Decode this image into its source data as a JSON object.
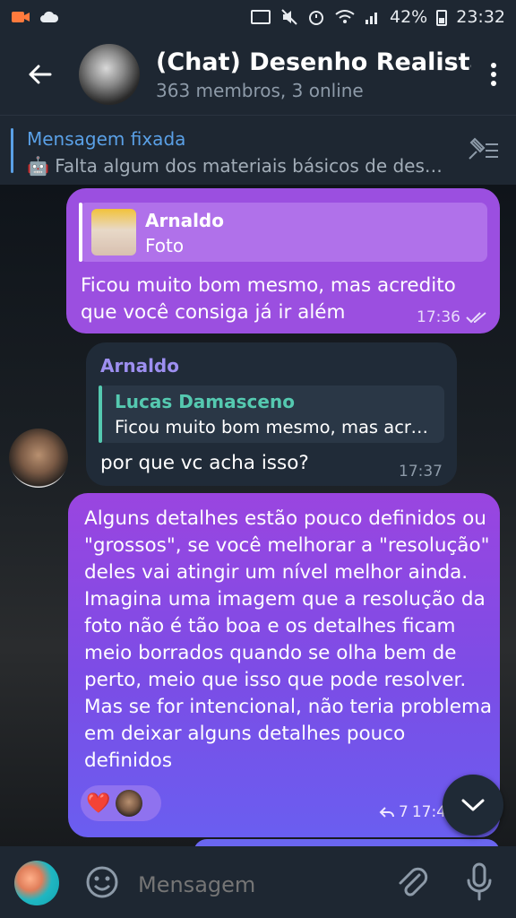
{
  "status_bar": {
    "battery": "42%",
    "time": "23:32"
  },
  "header": {
    "title": "(Chat) Desenho Realista",
    "subtitle": "363 membros, 3 online"
  },
  "pinned": {
    "label": "Mensagem fixada",
    "text": "🤖 Falta algum dos materiais básicos de desenho?"
  },
  "messages": [
    {
      "reply_name": "Arnaldo",
      "reply_text": "Foto",
      "text": "Ficou muito bom mesmo, mas acredito que você consiga já ir além",
      "time": "17:36"
    },
    {
      "sender": "Arnaldo",
      "reply_name": "Lucas Damasceno",
      "reply_text": "Ficou muito bom mesmo, mas acredito que você consiga já ir além",
      "text": "por que vc acha isso?",
      "time": "17:37"
    },
    {
      "text": "Alguns detalhes estão pouco definidos ou \"grossos\", se você melhorar a \"resolução\" deles vai atingir um nível melhor ainda. Imagina uma imagem que a resolução da foto não é tão boa e os detalhes ficam meio borrados quando se olha bem de perto, meio que isso que pode resolver. Mas se for intencional, não teria problema em deixar alguns detalhes pouco definidos",
      "reaction": "❤️",
      "reply_count": "7",
      "time": "17:4"
    }
  ],
  "input": {
    "placeholder": "Mensagem"
  },
  "colors": {
    "outgoing": "#9b4fe0",
    "incoming": "#202b38",
    "accent": "#5aa0e6",
    "reply_accent": "#55c9b0"
  },
  "icons": [
    "back-arrow-icon",
    "more-vert-icon",
    "pin-list-icon",
    "double-check-icon",
    "reply-icon",
    "chevron-down-icon",
    "emoji-icon",
    "attach-icon",
    "mic-icon"
  ]
}
